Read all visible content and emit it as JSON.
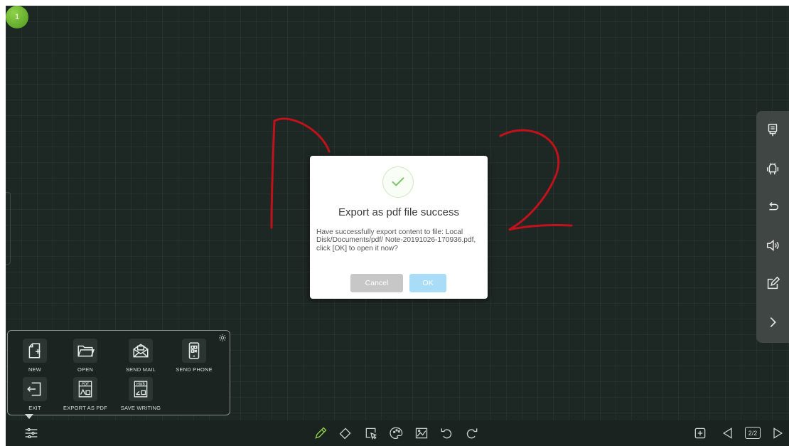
{
  "page_badge": "1",
  "dialog": {
    "title": "Export as pdf file success",
    "message": "Have successfully export content to file: Local Disk/Documents/pdf/ Note-20191026-170936.pdf, click [OK] to open it now?",
    "cancel_label": "Cancel",
    "ok_label": "OK",
    "icon": "checkmark-icon"
  },
  "menu": {
    "items": [
      {
        "label": "NEW",
        "icon": "new-page-icon"
      },
      {
        "label": "OPEN",
        "icon": "folder-icon"
      },
      {
        "label": "SEND MAIL",
        "icon": "mail-icon"
      },
      {
        "label": "SEND PHONE",
        "icon": "phone-qr-icon"
      },
      {
        "label": "EXIT",
        "icon": "exit-icon"
      },
      {
        "label": "EXPORT AS PDF",
        "icon": "pdf-icon"
      },
      {
        "label": "SAVE WRITING",
        "icon": "hwb-icon"
      }
    ],
    "settings_icon": "gear-icon"
  },
  "right_toolbar": [
    "usb-icon",
    "android-icon",
    "back-icon",
    "volume-icon",
    "edit-icon",
    "chevron-right-icon"
  ],
  "bottom_toolbar": [
    "pen-icon",
    "eraser-icon",
    "select-icon",
    "palette-icon",
    "insert-image-icon",
    "undo-icon",
    "redo-icon"
  ],
  "page_nav": {
    "indicator": "2/2",
    "icons": [
      "add-page-icon",
      "prev-page-icon",
      "next-page-icon"
    ]
  },
  "colors": {
    "board": "#1d2723",
    "ink": "#c1121c",
    "accent_ok": "#a9dcf6",
    "success": "#7cc56a"
  }
}
